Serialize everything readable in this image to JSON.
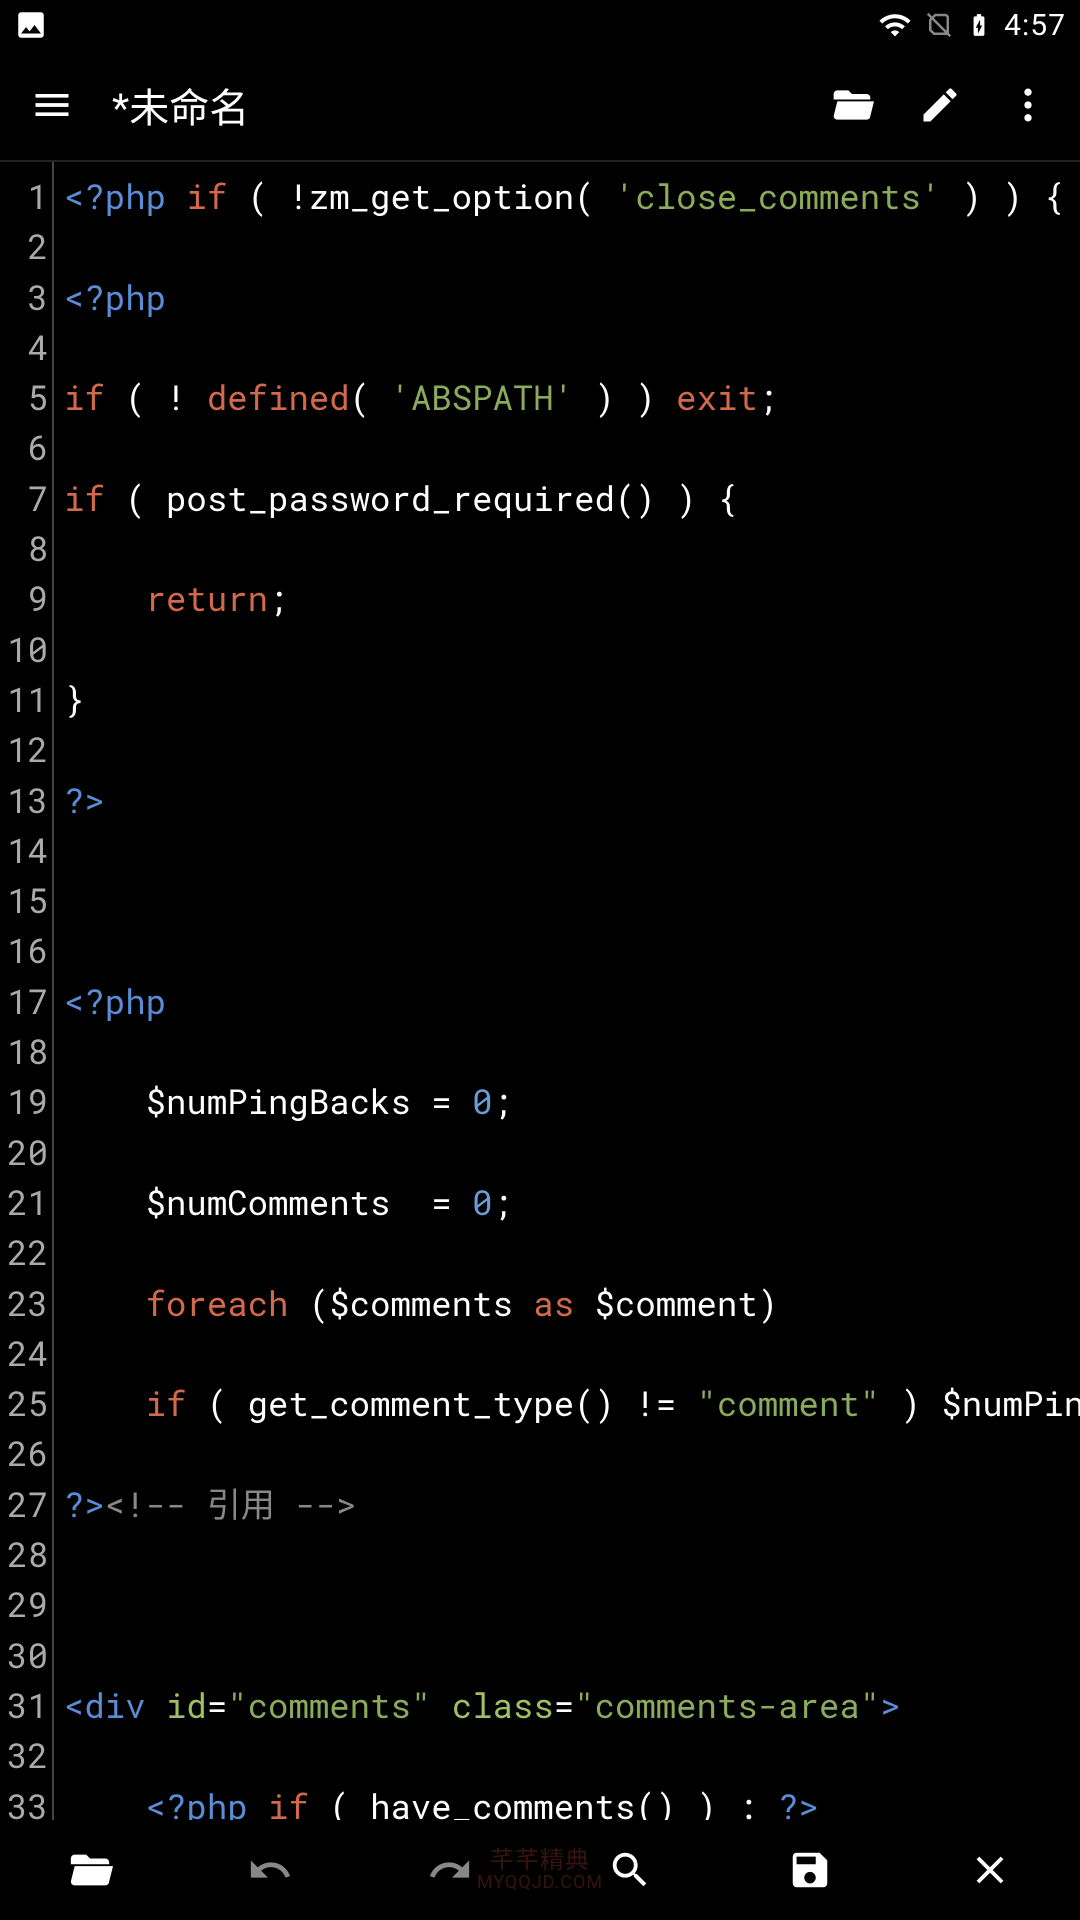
{
  "status": {
    "time": "4:57"
  },
  "appbar": {
    "title": "*未命名"
  },
  "code": {
    "lines": [
      [
        [
          "tag",
          "<?php "
        ],
        [
          "kw",
          "if"
        ],
        [
          "def",
          " ( !zm_get_option( "
        ],
        [
          "str",
          "'close_comments'"
        ],
        [
          "def",
          " ) ) { "
        ],
        [
          "tag",
          "?>"
        ]
      ],
      [],
      [
        [
          "tag",
          "<?php"
        ]
      ],
      [],
      [
        [
          "kw",
          "if"
        ],
        [
          "def",
          " ( ! "
        ],
        [
          "kw",
          "defined"
        ],
        [
          "def",
          "( "
        ],
        [
          "str",
          "'ABSPATH'"
        ],
        [
          "def",
          " ) ) "
        ],
        [
          "kw",
          "exit"
        ],
        [
          "def",
          ";"
        ]
      ],
      [],
      [
        [
          "kw",
          "if"
        ],
        [
          "def",
          " ( post_password_required() ) {"
        ]
      ],
      [],
      [
        [
          "def",
          "    "
        ],
        [
          "kw",
          "return"
        ],
        [
          "def",
          ";"
        ]
      ],
      [],
      [
        [
          "def",
          "}"
        ]
      ],
      [],
      [
        [
          "tag",
          "?>"
        ]
      ],
      [],
      [],
      [],
      [
        [
          "tag",
          "<?php"
        ]
      ],
      [],
      [
        [
          "def",
          "    $numPingBacks = "
        ],
        [
          "num",
          "0"
        ],
        [
          "def",
          ";"
        ]
      ],
      [],
      [
        [
          "def",
          "    $numComments  = "
        ],
        [
          "num",
          "0"
        ],
        [
          "def",
          ";"
        ]
      ],
      [],
      [
        [
          "def",
          "    "
        ],
        [
          "kw",
          "foreach"
        ],
        [
          "def",
          " ($comments "
        ],
        [
          "kw",
          "as"
        ],
        [
          "def",
          " $comment)"
        ]
      ],
      [],
      [
        [
          "def",
          "    "
        ],
        [
          "kw",
          "if"
        ],
        [
          "def",
          " ( get_comment_type() != "
        ],
        [
          "str",
          "\"comment\""
        ],
        [
          "def",
          " ) $numPingBacks++"
        ]
      ],
      [],
      [
        [
          "tag",
          "?>"
        ],
        [
          "cmt",
          "<!-- 引用 -->"
        ]
      ],
      [],
      [],
      [],
      [
        [
          "tag",
          "<div "
        ],
        [
          "attr",
          "id"
        ],
        [
          "def",
          "="
        ],
        [
          "str",
          "\"comments\""
        ],
        [
          "tag",
          " "
        ],
        [
          "attr",
          "class"
        ],
        [
          "def",
          "="
        ],
        [
          "str",
          "\"comments-area\""
        ],
        [
          "tag",
          ">"
        ]
      ],
      [],
      [
        [
          "def",
          "    "
        ],
        [
          "tag",
          "<?php "
        ],
        [
          "kw",
          "if"
        ],
        [
          "def",
          " ( have_comments() ) : "
        ],
        [
          "tag",
          "?>"
        ]
      ]
    ]
  },
  "watermark": {
    "top": "芊芊精典",
    "bottom": "MYQQJD.COM"
  }
}
